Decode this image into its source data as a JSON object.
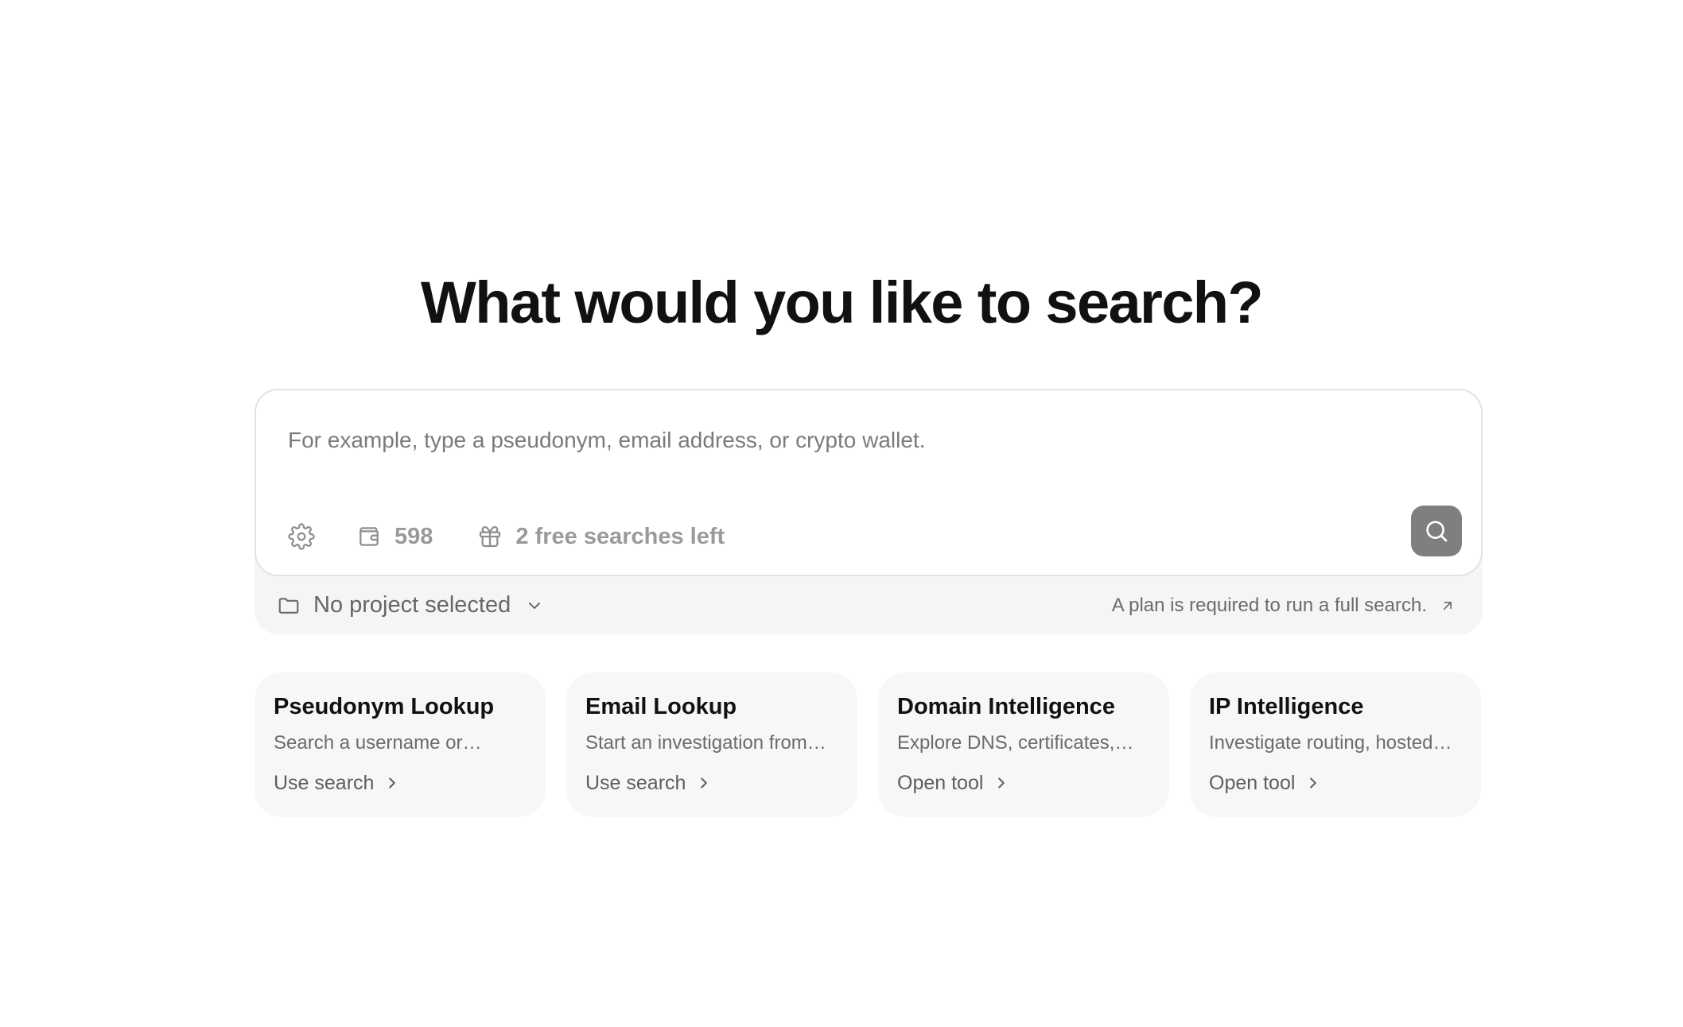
{
  "headline": "What would you like to search?",
  "search": {
    "placeholder": "For example, type a pseudonym, email address, or crypto wallet.",
    "credits": "598",
    "free_searches": "2 free searches left"
  },
  "project": {
    "selected": "No project selected",
    "plan_note": "A plan is required to run a full search."
  },
  "cards": [
    {
      "title": "Pseudonym Lookup",
      "desc": "Search a username or…",
      "action": "Use search"
    },
    {
      "title": "Email Lookup",
      "desc": "Start an investigation from…",
      "action": "Use search"
    },
    {
      "title": "Domain Intelligence",
      "desc": "Explore DNS, certificates,…",
      "action": "Open tool"
    },
    {
      "title": "IP Intelligence",
      "desc": "Investigate routing, hosted…",
      "action": "Open tool"
    }
  ],
  "icons": {
    "settings": "settings-gear-icon",
    "wallet": "wallet-icon",
    "gift": "gift-icon",
    "search": "search-icon",
    "folder": "folder-icon",
    "chevron_down": "chevron-down-icon",
    "arrow_up_right": "arrow-up-right-icon",
    "chevron_right": "chevron-right-icon"
  },
  "colors": {
    "search_button": "#7f7f7f",
    "card_background": "#f7f7f7",
    "panel_background": "#f5f5f5"
  }
}
